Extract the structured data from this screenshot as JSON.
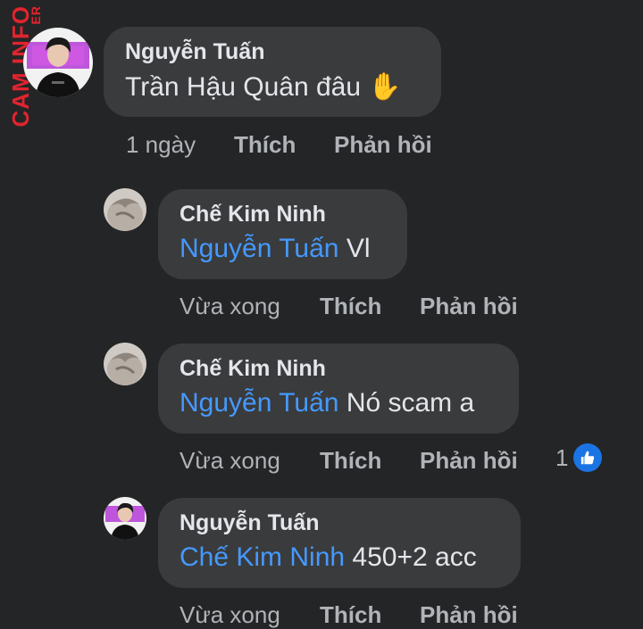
{
  "watermark": {
    "small": "ER",
    "main": "CAM.INFO"
  },
  "comments": [
    {
      "author": "Nguyễn Tuấn",
      "mention": "",
      "text": "Trần Hậu Quân đâu",
      "emoji": "✋",
      "time": "1 ngày",
      "like_label": "Thích",
      "reply_label": "Phản hồi"
    },
    {
      "author": "Chế Kim Ninh",
      "mention": "Nguyễn Tuấn",
      "text": "Vl",
      "time": "Vừa xong",
      "like_label": "Thích",
      "reply_label": "Phản hồi"
    },
    {
      "author": "Chế Kim Ninh",
      "mention": "Nguyễn Tuấn",
      "text": "Nó scam a",
      "time": "Vừa xong",
      "like_label": "Thích",
      "reply_label": "Phản hồi",
      "reaction_count": "1",
      "reaction_icon": "thumbs-up-icon"
    },
    {
      "author": "Nguyễn Tuấn",
      "mention": "Chế Kim Ninh",
      "text": "450+2 acc",
      "time": "Vừa xong",
      "like_label": "Thích",
      "reply_label": "Phản hồi"
    }
  ],
  "colors": {
    "background": "#242526",
    "bubble": "#3a3b3c",
    "mention": "#4599ff",
    "muted": "#b0b3b8",
    "like_badge": "#1b74e4",
    "watermark": "#e0242f"
  }
}
